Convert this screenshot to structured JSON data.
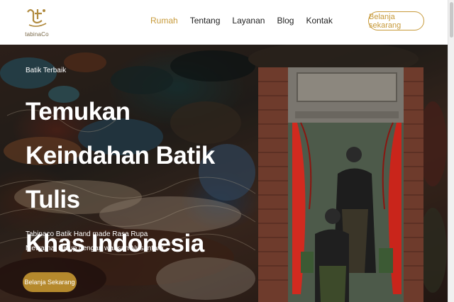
{
  "navbar": {
    "logo_text": "tabinaCo",
    "links": [
      "Rumah",
      "Tentang",
      "Layanan",
      "Blog",
      "Kontak"
    ],
    "active_link": "Rumah",
    "cta_label": "Belanja sekarang"
  },
  "hero": {
    "eyebrow": "Batik Terbaik",
    "title_lines": [
      "Temukan",
      "Keindahan Batik Tulis",
      "Khas Indonesia"
    ],
    "subtitle_lines": [
      "Tabinaco Batik Hand made Rasa Rupa",
      "Mewarnai Hidup dengan warisan Nusantara"
    ],
    "cta_label": "Belanja Sekarang"
  },
  "colors": {
    "accent": "#c79a3a",
    "cta_fill": "#b5892d",
    "text_dark": "#222222"
  }
}
